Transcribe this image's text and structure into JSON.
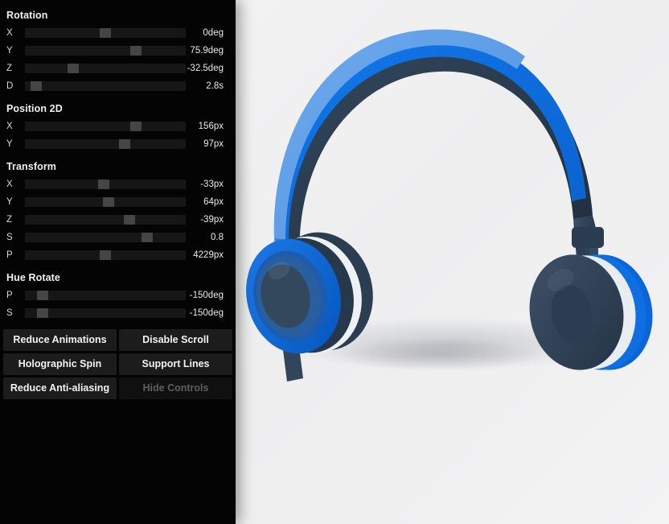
{
  "panel": {
    "groups": [
      {
        "id": "rotation",
        "title": "Rotation",
        "rows": [
          {
            "label": "X",
            "value": "0deg",
            "pos": 50
          },
          {
            "label": "Y",
            "value": "75.9deg",
            "pos": 69
          },
          {
            "label": "Z",
            "value": "-32.5deg",
            "pos": 30
          },
          {
            "label": "D",
            "value": "2.8s",
            "pos": 7
          }
        ]
      },
      {
        "id": "position",
        "title": "Position 2D",
        "rows": [
          {
            "label": "X",
            "value": "156px",
            "pos": 69
          },
          {
            "label": "Y",
            "value": "97px",
            "pos": 62
          }
        ]
      },
      {
        "id": "transform",
        "title": "Transform",
        "rows": [
          {
            "label": "X",
            "value": "-33px",
            "pos": 49
          },
          {
            "label": "Y",
            "value": "64px",
            "pos": 52
          },
          {
            "label": "Z",
            "value": "-39px",
            "pos": 65
          },
          {
            "label": "S",
            "value": "0.8",
            "pos": 76
          },
          {
            "label": "P",
            "value": "4229px",
            "pos": 50
          }
        ]
      },
      {
        "id": "hue",
        "title": "Hue Rotate",
        "rows": [
          {
            "label": "P",
            "value": "-150deg",
            "pos": 11
          },
          {
            "label": "S",
            "value": "-150deg",
            "pos": 11
          }
        ]
      }
    ],
    "buttons": [
      [
        {
          "label": "Reduce Animations",
          "dim": false
        },
        {
          "label": "Disable Scroll",
          "dim": false
        }
      ],
      [
        {
          "label": "Holographic Spin",
          "dim": false
        },
        {
          "label": "Support Lines",
          "dim": false
        }
      ],
      [
        {
          "label": "Reduce Anti-aliasing",
          "dim": false
        },
        {
          "label": "Hide Controls",
          "dim": true
        }
      ]
    ]
  },
  "stage": {
    "product_name": "headphones",
    "background_color": "#f2f2f3",
    "colors": {
      "headband_light_blue": "#5a9ce8",
      "headband_blue": "#0d6fe0",
      "headband_dark": "#2b3d4f",
      "frame_dark": "#2c3e50",
      "cup_blue": "#0a66d8",
      "cup_navy": "#234a78",
      "cup_dark": "#2f4255",
      "cup_inner_dark": "#37485c",
      "pad_white": "#eef1f3",
      "shadow": "rgba(110,115,125,0.20)"
    }
  }
}
